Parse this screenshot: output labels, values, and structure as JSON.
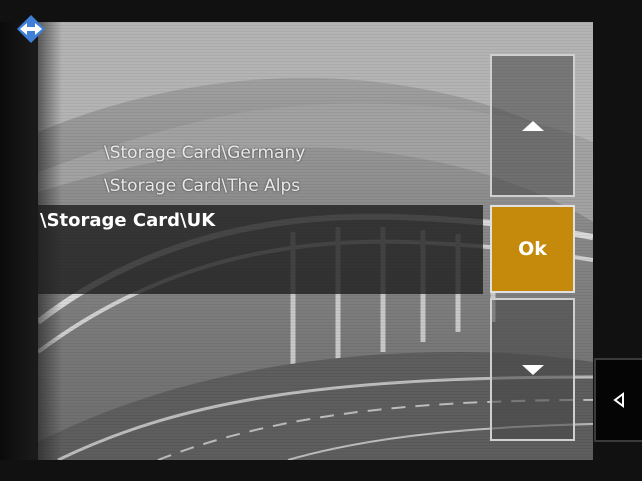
{
  "app": {
    "logo_icon": "diamond-arrows-icon",
    "logo_color": "#3f7fd8"
  },
  "folder_list": {
    "items": [
      {
        "label": "\\Storage Card\\Germany"
      },
      {
        "label": "\\Storage Card\\The Alps"
      }
    ],
    "selected": {
      "label": "\\Storage Card\\UK"
    }
  },
  "buttons": {
    "scroll_up_icon": "triangle-up-icon",
    "ok_label": "Ok",
    "ok_color": "#c58a0c",
    "scroll_down_icon": "triangle-down-icon",
    "back_icon": "triangle-left-icon"
  }
}
